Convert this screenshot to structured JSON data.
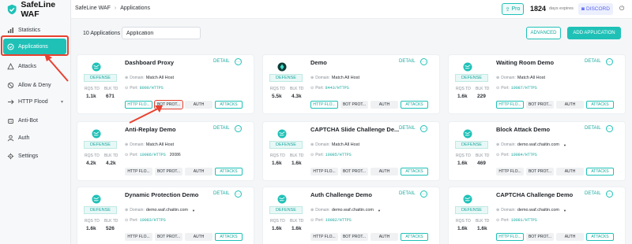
{
  "app": {
    "name": "SafeLine WAF"
  },
  "sidebar": {
    "items": [
      {
        "label": "Statistics",
        "icon": "chart-icon",
        "has_children": false
      },
      {
        "label": "Applications",
        "icon": "shield-icon",
        "has_children": false,
        "active": true
      },
      {
        "label": "Attacks",
        "icon": "warning-icon",
        "has_children": false
      },
      {
        "label": "Allow & Deny",
        "icon": "block-icon",
        "has_children": false
      },
      {
        "label": "HTTP Flood",
        "icon": "flood-icon",
        "has_children": true
      },
      {
        "label": "Anti-Bot",
        "icon": "bot-icon",
        "has_children": false
      },
      {
        "label": "Auth",
        "icon": "user-icon",
        "has_children": false
      },
      {
        "label": "Settings",
        "icon": "gear-icon",
        "has_children": false
      }
    ]
  },
  "header": {
    "breadcrumb": [
      "SafeLine WAF",
      "Applications"
    ],
    "pro_label": "Pro",
    "days_count": "1824",
    "days_label": "days expires",
    "discord_label": "DISCORD"
  },
  "toolbar": {
    "count_label": "10 Applications",
    "search_value": "Application",
    "advanced_label": "ADVANCED",
    "add_label": "ADD APPLICATION"
  },
  "labels": {
    "defense": "DEFENSE",
    "rqs": "RQS TD",
    "blk": "BLK TD",
    "detail": "DETAIL",
    "domain": "Domain:",
    "port": "Port:",
    "more": "···"
  },
  "modules": [
    "HTTP FLO...",
    "BOT PROT...",
    "AUTH",
    "ATTACKS"
  ],
  "cards": [
    {
      "title": "Dashboard Proxy",
      "domain": "Match All Host",
      "port": "8000/HTTPS",
      "port_extra": "",
      "rqs": "1.1k",
      "blk": "671",
      "icon": "globe-icon",
      "states": [
        1,
        0,
        0,
        1
      ]
    },
    {
      "title": "Demo",
      "domain": "Match All Host",
      "port": "8443/HTTPS",
      "port_extra": "",
      "rqs": "5.5k",
      "blk": "4.3k",
      "icon": "app-icon",
      "states": [
        1,
        0,
        0,
        1
      ]
    },
    {
      "title": "Waiting Room Demo",
      "domain": "Match All Host",
      "port": "10087/HTTPS",
      "port_extra": "",
      "rqs": "1.6k",
      "blk": "229",
      "icon": "globe-icon",
      "states": [
        1,
        0,
        0,
        1
      ]
    },
    {
      "title": "Anti-Replay Demo",
      "domain": "Match All Host",
      "port": "10086/HTTPS",
      "port_extra": "20086",
      "rqs": "4.2k",
      "blk": "4.2k",
      "icon": "globe-icon",
      "states": [
        0,
        0,
        0,
        1
      ]
    },
    {
      "title": "CAPTCHA Slide Challenge De...",
      "domain": "Match All Host",
      "port": "10085/HTTPS",
      "port_extra": "",
      "rqs": "1.6k",
      "blk": "1.6k",
      "icon": "globe-icon",
      "states": [
        0,
        0,
        0,
        1
      ]
    },
    {
      "title": "Block Attack Demo",
      "domain": "demo.waf.chaitin.com",
      "port": "10084/HTTPS",
      "port_extra": "",
      "rqs": "1.6k",
      "blk": "469",
      "icon": "globe-icon",
      "states": [
        0,
        0,
        0,
        1
      ]
    },
    {
      "title": "Dynamic Protection Demo",
      "domain": "demo.waf.chaitin.com",
      "port": "10083/HTTPS",
      "port_extra": "",
      "rqs": "1.6k",
      "blk": "526",
      "icon": "globe-icon",
      "states": [
        0,
        0,
        0,
        1
      ]
    },
    {
      "title": "Auth Challenge Demo",
      "domain": "demo.waf.chaitin.com",
      "port": "10082/HTTPS",
      "port_extra": "",
      "rqs": "1.6k",
      "blk": "1.6k",
      "icon": "globe-icon",
      "states": [
        0,
        0,
        0,
        1
      ]
    },
    {
      "title": "CAPTCHA Challenge Demo",
      "domain": "demo.waf.chaitin.com",
      "port": "10081/HTTPS",
      "port_extra": "",
      "rqs": "1.6k",
      "blk": "1.6k",
      "icon": "globe-icon",
      "states": [
        1,
        0,
        0,
        1
      ]
    }
  ],
  "colors": {
    "accent": "#1fc1b7",
    "annotation": "#e8412f"
  }
}
